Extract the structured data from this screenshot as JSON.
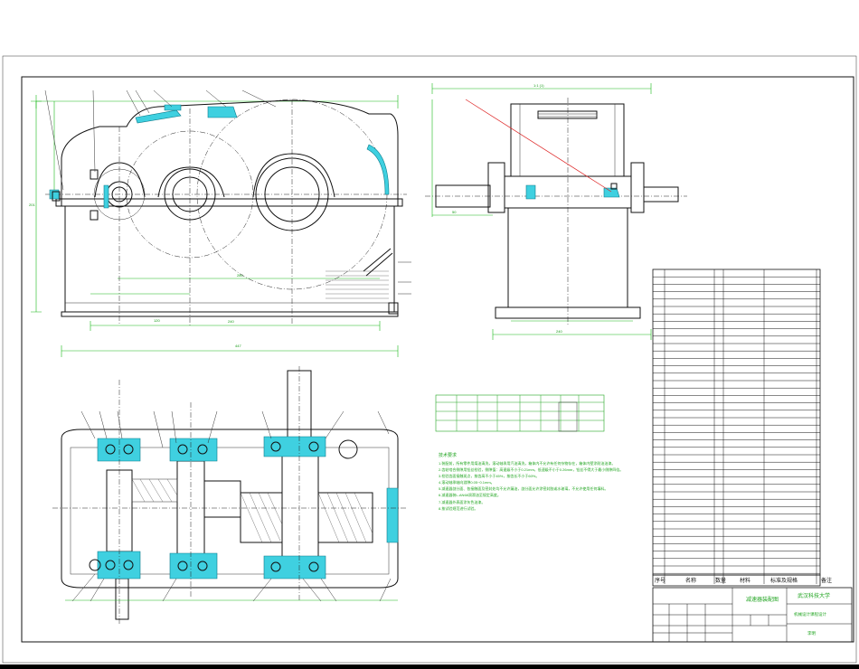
{
  "drawing": {
    "label_top_view": "1:1 (1)",
    "title_block": {
      "product_name": "减速器装配图",
      "school": "武汉科技大学",
      "course": "机械设计课程设计",
      "drawn_by": "李明"
    },
    "bom_header": {
      "seq": "序号",
      "name": "名称",
      "qty": "数量",
      "material": "材料",
      "standard": "标准及规格",
      "note": "备注"
    },
    "tech_req_title": "技术要求",
    "tech_requirements": [
      "1.装配前，所有零件用煤油清洗，滚动轴承用汽油清洗，箱体内不允许有任何杂物存在，箱体内壁涂耐油油漆。",
      "2.齿轮啮合侧隙用铅丝检验，侧隙值：高速级不小于0.21mm，低速级不小于0.26mm，铅丝不得大于最小侧隙四倍。",
      "3.检验齿面接触斑点，按齿高不小于45%，按齿长不小于60%。",
      "4.滚动轴承轴向游隙0.05~0.1mm。",
      "5.减速器剖分面、各接触面及密封处均不允许漏油，剖分面允许涂密封胶或水玻璃，不允许使用任何填料。",
      "6.减速器装L-AN68润滑油至规定高度。",
      "7.减速器外表面涂灰色油漆。",
      "8.按试验规范进行试验。"
    ]
  }
}
